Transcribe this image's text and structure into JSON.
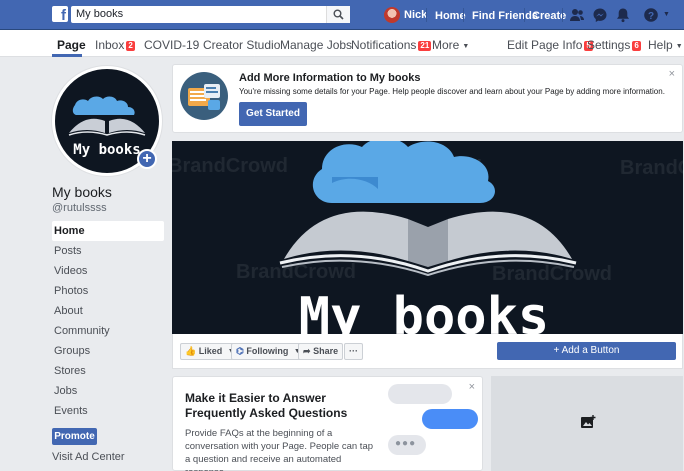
{
  "topbar": {
    "search_value": "My books",
    "user_name": "Nick",
    "links": [
      "Home",
      "Find Friends",
      "Create"
    ]
  },
  "pagenav": {
    "page_label": "Page",
    "inbox_label": "Inbox",
    "inbox_count": "2",
    "covid_label": "COVID-19",
    "creator_label": "Creator Studio",
    "jobs_label": "Manage Jobs",
    "notifications_label": "Notifications",
    "notifications_count": "21",
    "more_label": "More",
    "edit_info_label": "Edit Page Info",
    "edit_info_count": "5",
    "settings_label": "Settings",
    "settings_count": "6",
    "help_label": "Help"
  },
  "profile": {
    "name": "My books",
    "handle": "@rutulssss",
    "logo_text": "My books"
  },
  "sidebar": {
    "items": [
      "Home",
      "Posts",
      "Videos",
      "Photos",
      "About",
      "Community",
      "Groups",
      "Stores",
      "Jobs",
      "Events"
    ],
    "promote_label": "Promote",
    "visit_ad_label": "Visit Ad Center"
  },
  "banner": {
    "title": "Add More Information to My books",
    "text": "You're missing some details for your Page. Help people discover and learn about your Page by adding more information.",
    "button": "Get Started",
    "close": "×"
  },
  "cover": {
    "logo_text": "My books",
    "watermark": "BrandCrowd"
  },
  "actions": {
    "liked": "Liked",
    "following": "Following",
    "share": "Share",
    "more": "···",
    "add_button": "Add a Button"
  },
  "faq": {
    "title": "Make it Easier to Answer Frequently Asked Questions",
    "text": "Provide FAQs at the beginning of a conversation with your Page. People can tap a question and receive an automated response.",
    "close": "×"
  },
  "colors": {
    "brand_blue": "#4267b2",
    "cover_bg": "#0e1621",
    "cloud_blue": "#5aa8e6",
    "badge_red": "#fa3e3e"
  },
  "icons": [
    "facebook-logo",
    "search-icon",
    "friends-icon",
    "messenger-icon",
    "bell-icon",
    "help-icon",
    "caret-down-icon",
    "add-photo-icon",
    "close-icon",
    "plus-icon"
  ]
}
